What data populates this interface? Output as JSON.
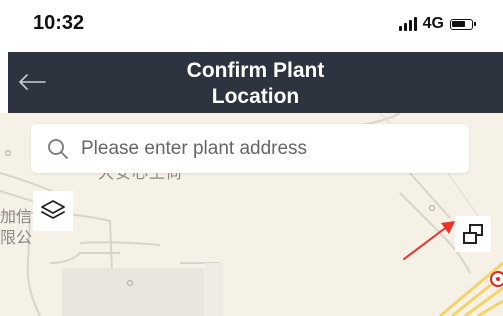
{
  "status_bar": {
    "time": "10:32",
    "network": "4G",
    "icons": [
      "signal-bars-icon",
      "battery-icon"
    ]
  },
  "nav": {
    "title_line1": "Confirm Plant",
    "title_line2": "Location",
    "back_icon": "arrow-left-icon",
    "background_color": "#2d333f"
  },
  "search": {
    "placeholder": "Please enter plant address",
    "value": "",
    "icon": "search-icon"
  },
  "map": {
    "labels": {
      "top": "大安心王尚",
      "left_line1": "加信息",
      "left_line2": "限公"
    },
    "controls": {
      "layers_icon": "layers-icon",
      "switch_icon": "map-switch-icon"
    },
    "annotation_color": "#e8322a",
    "background_color": "#f6f1e6"
  }
}
